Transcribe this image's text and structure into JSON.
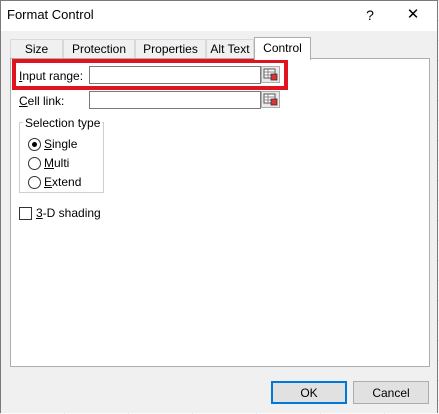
{
  "dialog": {
    "title": "Format Control",
    "help_glyph": "?",
    "close_glyph": "✕"
  },
  "tabs": [
    {
      "label": "Size",
      "active": false
    },
    {
      "label": "Protection",
      "active": false
    },
    {
      "label": "Properties",
      "active": false
    },
    {
      "label": "Alt Text",
      "active": false
    },
    {
      "label": "Control",
      "active": true
    }
  ],
  "control": {
    "input_range": {
      "label_mnemonic": "I",
      "label_rest": "nput range:",
      "value": "",
      "picker_icon": "range-picker-icon"
    },
    "cell_link": {
      "label_mnemonic": "C",
      "label_rest": "ell link:",
      "value": "",
      "picker_icon": "range-picker-icon"
    },
    "selection_type": {
      "title": "Selection type",
      "options": [
        {
          "mnemonic": "S",
          "rest": "ingle",
          "selected": true
        },
        {
          "mnemonic": "M",
          "rest": "ulti",
          "selected": false
        },
        {
          "mnemonic": "E",
          "rest": "xtend",
          "selected": false
        }
      ]
    },
    "shading": {
      "mnemonic": "3",
      "rest": "-D shading",
      "checked": false
    }
  },
  "footer": {
    "ok_label": "OK",
    "cancel_label": "Cancel"
  },
  "colors": {
    "highlight": "#e0141e",
    "default_button_border": "#0078d7"
  }
}
